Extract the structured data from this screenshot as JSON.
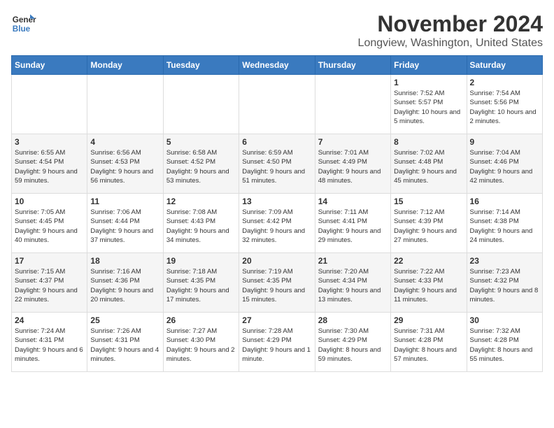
{
  "header": {
    "logo_text_line1": "General",
    "logo_text_line2": "Blue",
    "month_title": "November 2024",
    "location": "Longview, Washington, United States"
  },
  "days_of_week": [
    "Sunday",
    "Monday",
    "Tuesday",
    "Wednesday",
    "Thursday",
    "Friday",
    "Saturday"
  ],
  "weeks": [
    [
      {
        "day": "",
        "info": ""
      },
      {
        "day": "",
        "info": ""
      },
      {
        "day": "",
        "info": ""
      },
      {
        "day": "",
        "info": ""
      },
      {
        "day": "",
        "info": ""
      },
      {
        "day": "1",
        "info": "Sunrise: 7:52 AM\nSunset: 5:57 PM\nDaylight: 10 hours and 5 minutes."
      },
      {
        "day": "2",
        "info": "Sunrise: 7:54 AM\nSunset: 5:56 PM\nDaylight: 10 hours and 2 minutes."
      }
    ],
    [
      {
        "day": "3",
        "info": "Sunrise: 6:55 AM\nSunset: 4:54 PM\nDaylight: 9 hours and 59 minutes."
      },
      {
        "day": "4",
        "info": "Sunrise: 6:56 AM\nSunset: 4:53 PM\nDaylight: 9 hours and 56 minutes."
      },
      {
        "day": "5",
        "info": "Sunrise: 6:58 AM\nSunset: 4:52 PM\nDaylight: 9 hours and 53 minutes."
      },
      {
        "day": "6",
        "info": "Sunrise: 6:59 AM\nSunset: 4:50 PM\nDaylight: 9 hours and 51 minutes."
      },
      {
        "day": "7",
        "info": "Sunrise: 7:01 AM\nSunset: 4:49 PM\nDaylight: 9 hours and 48 minutes."
      },
      {
        "day": "8",
        "info": "Sunrise: 7:02 AM\nSunset: 4:48 PM\nDaylight: 9 hours and 45 minutes."
      },
      {
        "day": "9",
        "info": "Sunrise: 7:04 AM\nSunset: 4:46 PM\nDaylight: 9 hours and 42 minutes."
      }
    ],
    [
      {
        "day": "10",
        "info": "Sunrise: 7:05 AM\nSunset: 4:45 PM\nDaylight: 9 hours and 40 minutes."
      },
      {
        "day": "11",
        "info": "Sunrise: 7:06 AM\nSunset: 4:44 PM\nDaylight: 9 hours and 37 minutes."
      },
      {
        "day": "12",
        "info": "Sunrise: 7:08 AM\nSunset: 4:43 PM\nDaylight: 9 hours and 34 minutes."
      },
      {
        "day": "13",
        "info": "Sunrise: 7:09 AM\nSunset: 4:42 PM\nDaylight: 9 hours and 32 minutes."
      },
      {
        "day": "14",
        "info": "Sunrise: 7:11 AM\nSunset: 4:41 PM\nDaylight: 9 hours and 29 minutes."
      },
      {
        "day": "15",
        "info": "Sunrise: 7:12 AM\nSunset: 4:39 PM\nDaylight: 9 hours and 27 minutes."
      },
      {
        "day": "16",
        "info": "Sunrise: 7:14 AM\nSunset: 4:38 PM\nDaylight: 9 hours and 24 minutes."
      }
    ],
    [
      {
        "day": "17",
        "info": "Sunrise: 7:15 AM\nSunset: 4:37 PM\nDaylight: 9 hours and 22 minutes."
      },
      {
        "day": "18",
        "info": "Sunrise: 7:16 AM\nSunset: 4:36 PM\nDaylight: 9 hours and 20 minutes."
      },
      {
        "day": "19",
        "info": "Sunrise: 7:18 AM\nSunset: 4:35 PM\nDaylight: 9 hours and 17 minutes."
      },
      {
        "day": "20",
        "info": "Sunrise: 7:19 AM\nSunset: 4:35 PM\nDaylight: 9 hours and 15 minutes."
      },
      {
        "day": "21",
        "info": "Sunrise: 7:20 AM\nSunset: 4:34 PM\nDaylight: 9 hours and 13 minutes."
      },
      {
        "day": "22",
        "info": "Sunrise: 7:22 AM\nSunset: 4:33 PM\nDaylight: 9 hours and 11 minutes."
      },
      {
        "day": "23",
        "info": "Sunrise: 7:23 AM\nSunset: 4:32 PM\nDaylight: 9 hours and 8 minutes."
      }
    ],
    [
      {
        "day": "24",
        "info": "Sunrise: 7:24 AM\nSunset: 4:31 PM\nDaylight: 9 hours and 6 minutes."
      },
      {
        "day": "25",
        "info": "Sunrise: 7:26 AM\nSunset: 4:31 PM\nDaylight: 9 hours and 4 minutes."
      },
      {
        "day": "26",
        "info": "Sunrise: 7:27 AM\nSunset: 4:30 PM\nDaylight: 9 hours and 2 minutes."
      },
      {
        "day": "27",
        "info": "Sunrise: 7:28 AM\nSunset: 4:29 PM\nDaylight: 9 hours and 1 minute."
      },
      {
        "day": "28",
        "info": "Sunrise: 7:30 AM\nSunset: 4:29 PM\nDaylight: 8 hours and 59 minutes."
      },
      {
        "day": "29",
        "info": "Sunrise: 7:31 AM\nSunset: 4:28 PM\nDaylight: 8 hours and 57 minutes."
      },
      {
        "day": "30",
        "info": "Sunrise: 7:32 AM\nSunset: 4:28 PM\nDaylight: 8 hours and 55 minutes."
      }
    ]
  ]
}
